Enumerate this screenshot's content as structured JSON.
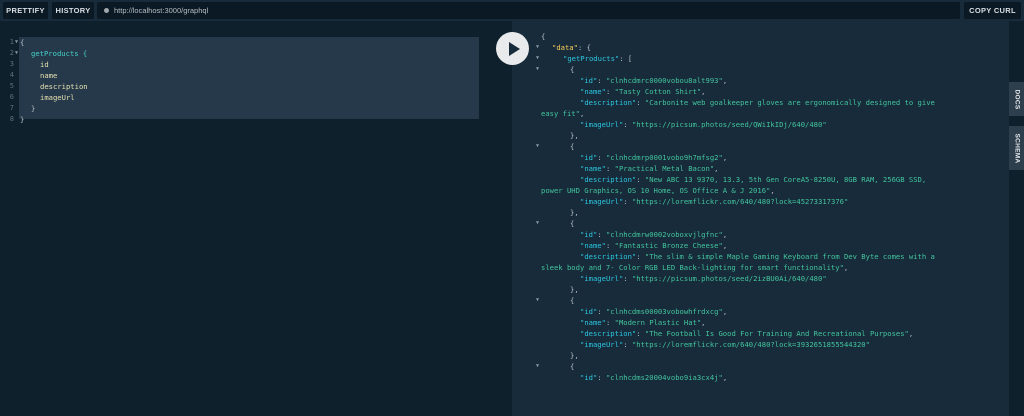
{
  "toolbar": {
    "prettify_label": "PRETTIFY",
    "history_label": "HISTORY",
    "endpoint_url": "http://localhost:3000/graphql",
    "copy_curl_label": "COPY CURL"
  },
  "sidetabs": {
    "docs_label": "DOCS",
    "schema_label": "SCHEMA"
  },
  "query": {
    "line_numbers": [
      "1",
      "2",
      "3",
      "4",
      "5",
      "6",
      "7",
      "8"
    ],
    "lines": [
      "{",
      "getProducts {",
      "id",
      "name",
      "description",
      "imageUrl",
      "}",
      "}"
    ]
  },
  "result": {
    "open_brace": "{",
    "data_key": "\"data\"",
    "get_products_key": "\"getProducts\"",
    "products": [
      {
        "id_key": "\"id\"",
        "id": "\"clnhcdmrc0000vobou8alt993\"",
        "name_key": "\"name\"",
        "name": "\"Tasty Cotton Shirt\"",
        "description_key": "\"description\"",
        "description_1": "\"Carbonite web goalkeeper gloves are ergonomically designed to give",
        "description_2": "easy fit\"",
        "image_key": "\"imageUrl\"",
        "imageUrl": "\"https://picsum.photos/seed/QWiIkIDj/640/480\""
      },
      {
        "id_key": "\"id\"",
        "id": "\"clnhcdmrp0001vobo9h7mfsg2\"",
        "name_key": "\"name\"",
        "name": "\"Practical Metal Bacon\"",
        "description_key": "\"description\"",
        "description_1": "\"New ABC 13 9370, 13.3, 5th Gen CoreA5-8250U, 8GB RAM, 256GB SSD,",
        "description_2": "power UHD Graphics, OS 10 Home, OS Office A & J 2016\"",
        "image_key": "\"imageUrl\"",
        "imageUrl": "\"https://loremflickr.com/640/480?lock=45273317376\""
      },
      {
        "id_key": "\"id\"",
        "id": "\"clnhcdmrw0002voboxvjlgfnc\"",
        "name_key": "\"name\"",
        "name": "\"Fantastic Bronze Cheese\"",
        "description_key": "\"description\"",
        "description_1": "\"The slim & simple Maple Gaming Keyboard from Dev Byte comes with a",
        "description_2": "sleek body and 7- Color RGB LED Back-lighting for smart functionality\"",
        "image_key": "\"imageUrl\"",
        "imageUrl": "\"https://picsum.photos/seed/2izBU0Ai/640/480\""
      },
      {
        "id_key": "\"id\"",
        "id": "\"clnhcdms00003vobowhfrdxcg\"",
        "name_key": "\"name\"",
        "name": "\"Modern Plastic Hat\"",
        "description_key": "\"description\"",
        "description_1": "\"The Football Is Good For Training And Recreational Purposes\"",
        "image_key": "\"imageUrl\"",
        "imageUrl": "\"https://loremflickr.com/640/480?lock=3932651855544320\""
      },
      {
        "id_key": "\"id\"",
        "id": "\"clnhcdms20004vobo9ia3cx4j\""
      }
    ]
  }
}
